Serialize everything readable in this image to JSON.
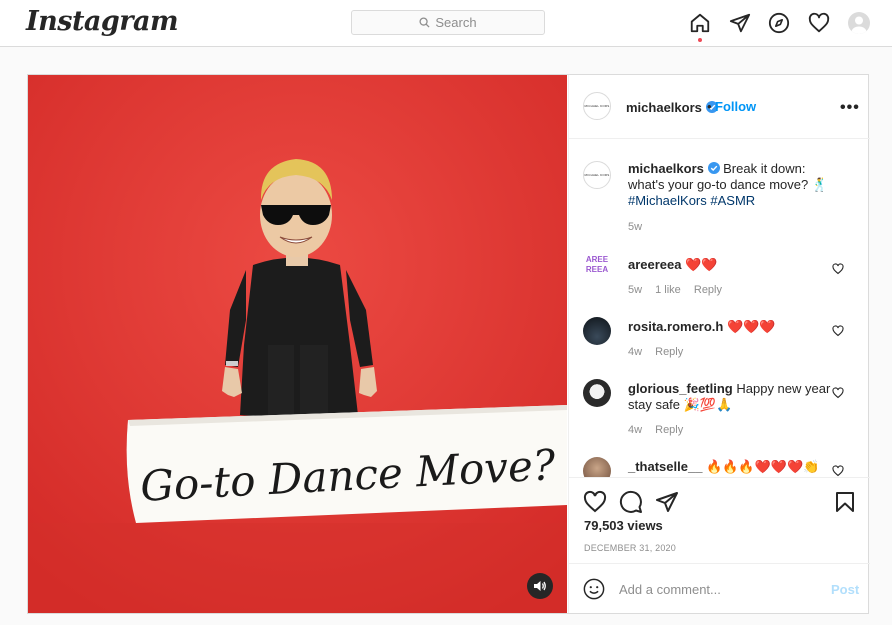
{
  "topbar": {
    "logo": "Instagram",
    "search_placeholder": "Search"
  },
  "post": {
    "media_caption_card": "Go-to Dance Move?",
    "header": {
      "avatar_text": "MICHAEL KORS",
      "username": "michaelkors",
      "separator": "•",
      "follow_label": "Follow",
      "more_label": "•••"
    },
    "caption": {
      "username": "michaelkors",
      "text": "Break it down: what's your go-to dance move? 🕺",
      "hashtags": "#MichaelKors #ASMR",
      "time": "5w"
    },
    "comments": [
      {
        "username": "areereea",
        "text": "❤️❤️",
        "time": "5w",
        "likes": "1 like",
        "reply": "Reply",
        "avatar_text": "AREE REEA"
      },
      {
        "username": "rosita.romero.h",
        "text": "❤️❤️❤️",
        "time": "4w",
        "reply": "Reply"
      },
      {
        "username": "glorious_feetling",
        "text": "Happy new year stay safe 🎉💯🙏",
        "time": "4w",
        "reply": "Reply"
      },
      {
        "username": "_thatselle__",
        "text": "🔥🔥🔥❤️❤️❤️👏"
      }
    ],
    "views": "79,503 views",
    "date": "DECEMBER 31, 2020",
    "comment_placeholder": "Add a comment...",
    "post_label": "Post"
  },
  "colors": {
    "accent": "#0095f6",
    "heart_red": "#ed4956",
    "media_red": "#e23b35"
  }
}
